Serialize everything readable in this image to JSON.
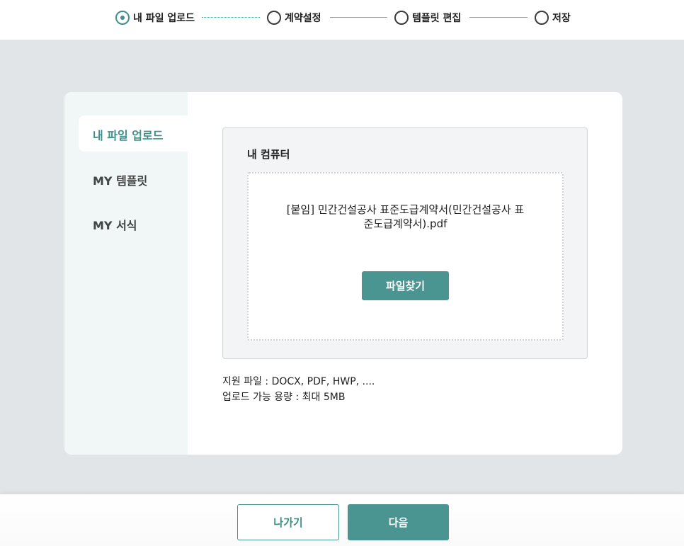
{
  "stepper": {
    "steps": [
      {
        "label": "내 파일 업로드",
        "active": true
      },
      {
        "label": "계약설정",
        "active": false
      },
      {
        "label": "템플릿 편집",
        "active": false
      },
      {
        "label": "저장",
        "active": false
      }
    ]
  },
  "sidebar": {
    "items": [
      {
        "label": "내 파일 업로드",
        "active": true
      },
      {
        "label": "MY 템플릿",
        "active": false
      },
      {
        "label": "MY 서식",
        "active": false
      }
    ]
  },
  "upload": {
    "title": "내 컴퓨터",
    "filename_line1": "[붙임] 민간건설공사 표준도급계약서(민간건설공사 표",
    "filename_line2": "준도급계약서).pdf",
    "find_button": "파일찾기"
  },
  "info": {
    "supported": "지원 파일 : DOCX, PDF, HWP, ....",
    "max_size": "업로드 가능 용량 : 최대 5MB"
  },
  "footer": {
    "back_label": "나가기",
    "next_label": "다음"
  },
  "colors": {
    "accent": "#4a9491",
    "background": "#e1e5e7",
    "sidebar": "#f1f6f7"
  }
}
